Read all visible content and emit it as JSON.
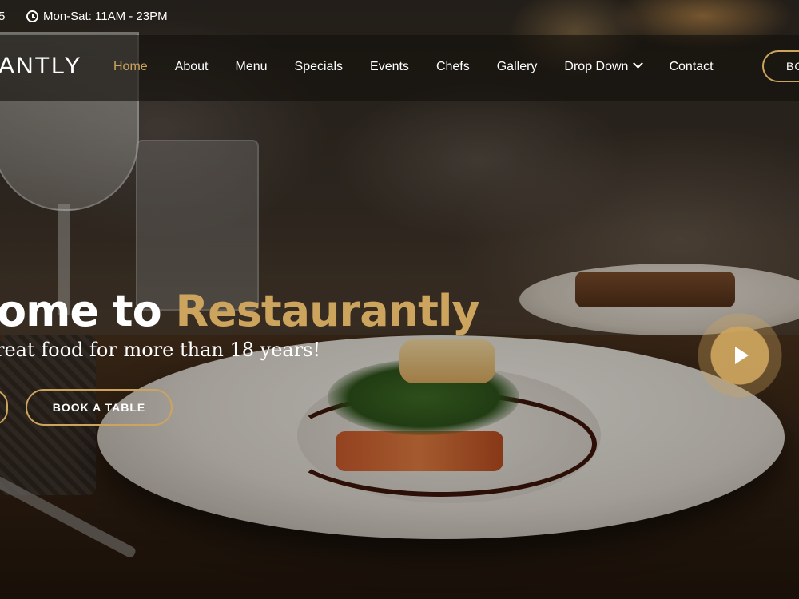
{
  "topbar": {
    "phone_fragment": "5",
    "hours": "Mon-Sat: 11AM - 23PM",
    "clock_icon": "clock-icon"
  },
  "nav": {
    "logo": "ANTLY",
    "items": [
      {
        "label": "Home",
        "active": true
      },
      {
        "label": "About"
      },
      {
        "label": "Menu"
      },
      {
        "label": "Specials"
      },
      {
        "label": "Events"
      },
      {
        "label": "Chefs"
      },
      {
        "label": "Gallery"
      },
      {
        "label": "Drop Down",
        "icon": "chevron-down-icon"
      },
      {
        "label": "Contact"
      }
    ],
    "book_button": "BC"
  },
  "hero": {
    "title_prefix": "ome to ",
    "title_brand": "Restaurantly",
    "subtitle": "reat food for more than 18 years!",
    "book_table_button": "BOOK A TABLE",
    "play_icon": "play-icon"
  },
  "colors": {
    "accent": "#cda45e",
    "nav_bg": "rgba(20,16,12,0.62)"
  }
}
